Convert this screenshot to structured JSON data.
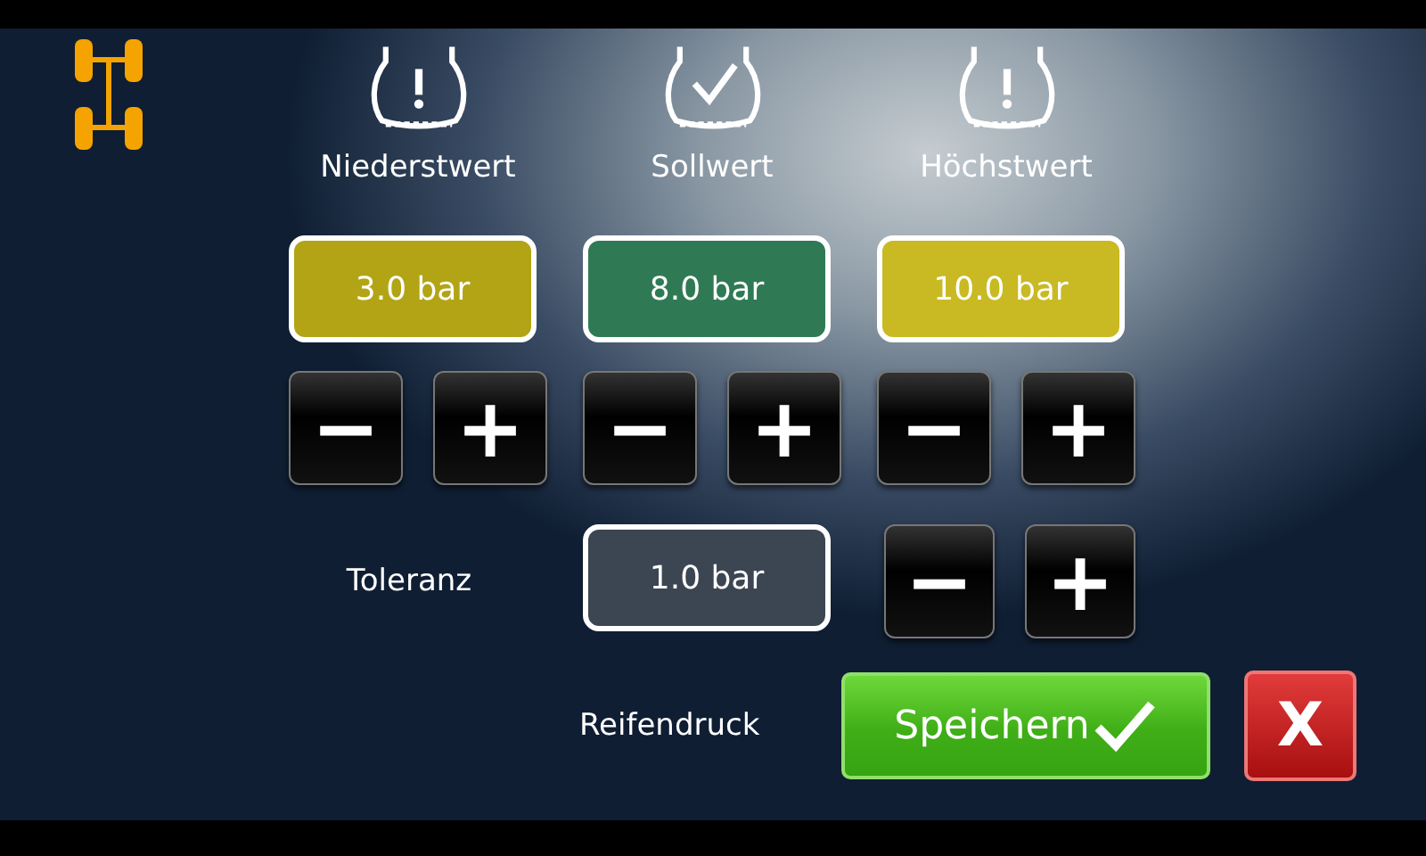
{
  "limits": [
    {
      "label": "Niederstwert",
      "kind": "warning",
      "value": "3.0 bar",
      "color": "#b3a416",
      "minus": "−",
      "plus": "+"
    },
    {
      "label": "Sollwert",
      "kind": "ok",
      "value": "8.0 bar",
      "color": "#2f7a55",
      "minus": "−",
      "plus": "+"
    },
    {
      "label": "Höchstwert",
      "kind": "warning",
      "value": "10.0 bar",
      "color": "#c9b923",
      "minus": "−",
      "plus": "+"
    }
  ],
  "tolerance": {
    "label": "Toleranz",
    "value": "1.0 bar",
    "color": "#3c4552",
    "minus": "−",
    "plus": "+"
  },
  "footer": {
    "label": "Reifendruck",
    "save": "Speichern",
    "cancel": "X"
  }
}
